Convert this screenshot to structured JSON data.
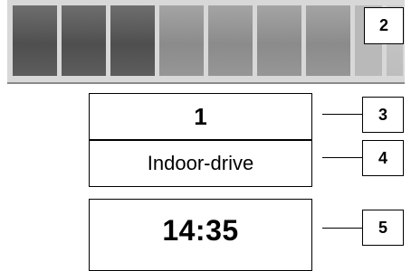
{
  "callouts": {
    "c2": "2",
    "c3": "3",
    "c4": "4",
    "c5": "5"
  },
  "display": {
    "number": "1",
    "mode": "Indoor-drive",
    "time": "14:35"
  },
  "bar": {
    "segments_dark": 3,
    "segments_light": 4
  }
}
